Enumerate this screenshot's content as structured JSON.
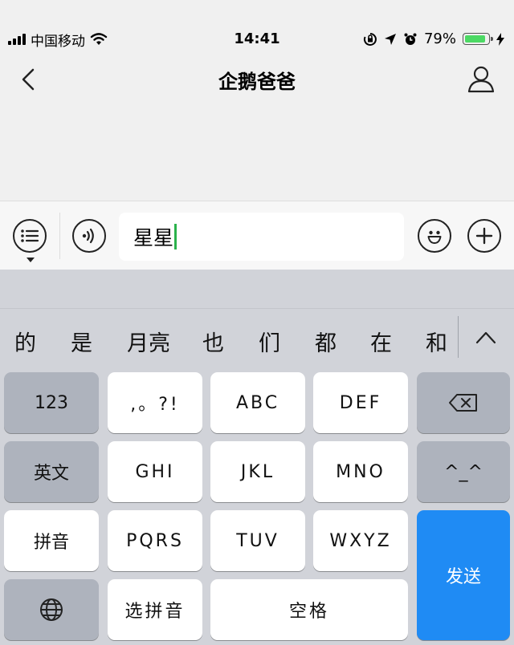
{
  "status_bar": {
    "carrier": "中国移动",
    "time": "14:41",
    "battery": "79%",
    "battery_level": 0.79,
    "colors": {
      "battery_fill": "#4cd964"
    }
  },
  "nav": {
    "title": "企鹅爸爸",
    "icons": {
      "back": "chevron-left-icon",
      "profile": "person-icon"
    }
  },
  "input_bar": {
    "text_value": "星星",
    "icons": [
      "list-menu-icon",
      "voice-icon",
      "emoji-icon",
      "plus-icon"
    ],
    "cursor_color": "#2bb24c"
  },
  "keyboard": {
    "candidates": [
      "的",
      "是",
      "月亮",
      "也",
      "们",
      "都",
      "在",
      "和"
    ],
    "rows": {
      "r1": [
        "123",
        ",。?!",
        "ABC",
        "DEF"
      ],
      "r2": [
        "英文",
        "GHI",
        "JKL",
        "MNO",
        "^_^"
      ],
      "r3": [
        "拼音",
        "PQRS",
        "TUV",
        "WXYZ"
      ],
      "r4": [
        "选拼音",
        "空格"
      ]
    },
    "send_label": "发送",
    "icons": [
      "backspace-icon",
      "globe-icon",
      "chevron-up-icon"
    ],
    "colors": {
      "send": "#1f8bf4",
      "dark_key": "#aeb3bd",
      "light_key": "#ffffff"
    }
  }
}
